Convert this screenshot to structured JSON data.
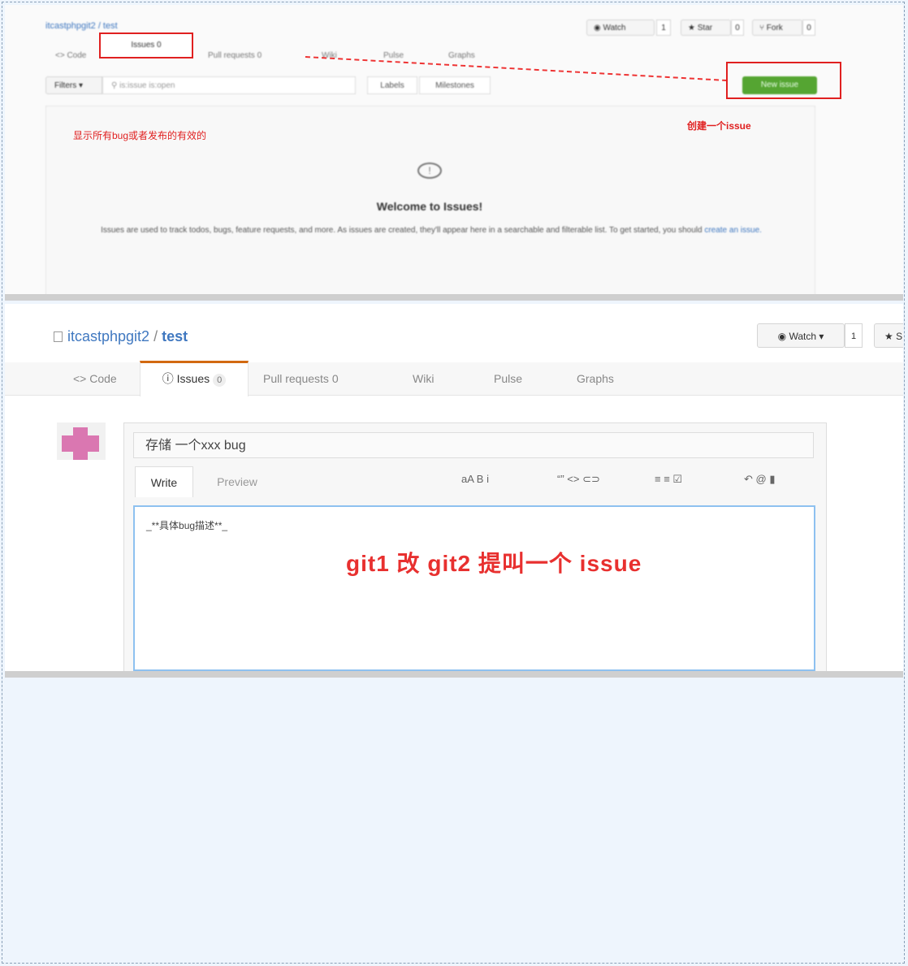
{
  "screenshot1": {
    "repo_path": "itcastphpgit2 / test",
    "header_buttons": [
      {
        "label": "Watch",
        "count": "1"
      },
      {
        "label": "Star",
        "count": "0"
      },
      {
        "label": "Fork",
        "count": "0"
      }
    ],
    "tabs": [
      {
        "label": "<> Code"
      },
      {
        "label": "Issues 0",
        "active": true
      },
      {
        "label": "Pull requests 0"
      },
      {
        "label": "Wiki"
      },
      {
        "label": "Pulse"
      },
      {
        "label": "Graphs"
      }
    ],
    "filters_label": "Filters",
    "search_placeholder": "is:issue is:open",
    "labels_button": "Labels",
    "milestones_button": "Milestones",
    "new_issue_button": "New issue",
    "annotation_left": "显示所有bug或者发布的有效的",
    "annotation_right": "创建一个issue",
    "welcome_title": "Welcome to Issues!",
    "welcome_desc": "Issues are used to track todos, bugs, feature requests, and more. As issues are created, they'll appear here in a searchable and filterable list. To get started, you should",
    "welcome_link": "create an issue."
  },
  "screenshot2": {
    "owner": "itcastphpgit2",
    "slash": " / ",
    "repo": "test",
    "watch_label": "Watch",
    "watch_count": "1",
    "star_label": "S",
    "tabs": [
      {
        "label": "<> Code"
      },
      {
        "label": "Issues",
        "count": "0",
        "active": true
      },
      {
        "label": "Pull requests 0"
      },
      {
        "label": "Wiki"
      },
      {
        "label": "Pulse"
      },
      {
        "label": "Graphs"
      }
    ],
    "issue_title_value": "存储 一个xxx bug",
    "write_tab": "Write",
    "preview_tab": "Preview",
    "toolbar_group1": "aA  B  i",
    "toolbar_group2": "“”  <>  ⊂⊃",
    "toolbar_group3": "≡  ≡  ☑",
    "toolbar_group4": "↶  @  ▮",
    "editor_text": "_**具体bug描述**_",
    "annotation": "git1 改 git2 提叫一个 issue"
  },
  "colors": {
    "accent_red": "#e02020",
    "link_blue": "#4078c0",
    "new_issue_green": "#55a532",
    "active_tab_orange": "#d26911"
  }
}
